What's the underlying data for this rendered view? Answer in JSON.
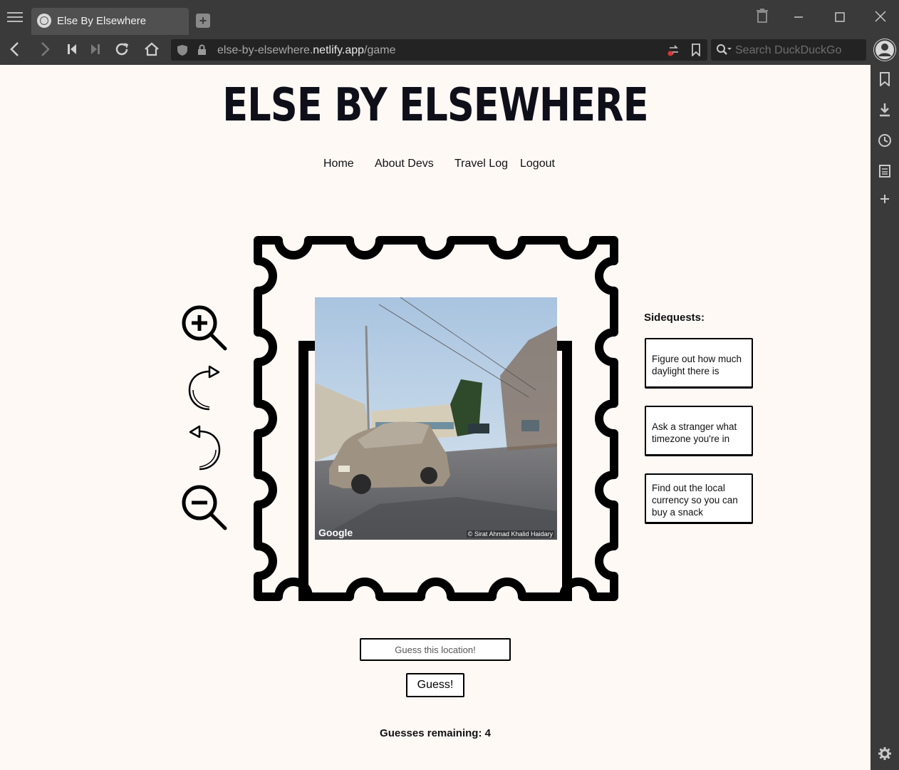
{
  "browser": {
    "tab_title": "Else By Elsewhere",
    "newtab_icon": "plus-icon",
    "url_host_prefix": "else-by-elsewhere.",
    "url_host_domain": "netlify.app",
    "url_path": "/game",
    "search_placeholder": "Search DuckDuckGo"
  },
  "site": {
    "title": "ELSE BY ELSEWHERE",
    "nav": [
      "Home",
      "About Devs",
      "Travel Log",
      "Logout"
    ]
  },
  "viewer": {
    "controls": [
      "zoom-in-icon",
      "rotate-right-icon",
      "rotate-left-icon",
      "zoom-out-icon"
    ],
    "photo_logo": "Google",
    "photo_credit": "© Sirat Ahmad Khalid Haidary"
  },
  "sidequests": {
    "label": "Sidequests:",
    "items": [
      "Figure out how much daylight there is",
      "Ask a stranger what timezone you're in",
      "Find out the local currency so you can buy a snack"
    ]
  },
  "guess": {
    "placeholder": "Guess this location!",
    "button_label": "Guess!",
    "remaining_label": "Guesses remaining: 4"
  }
}
